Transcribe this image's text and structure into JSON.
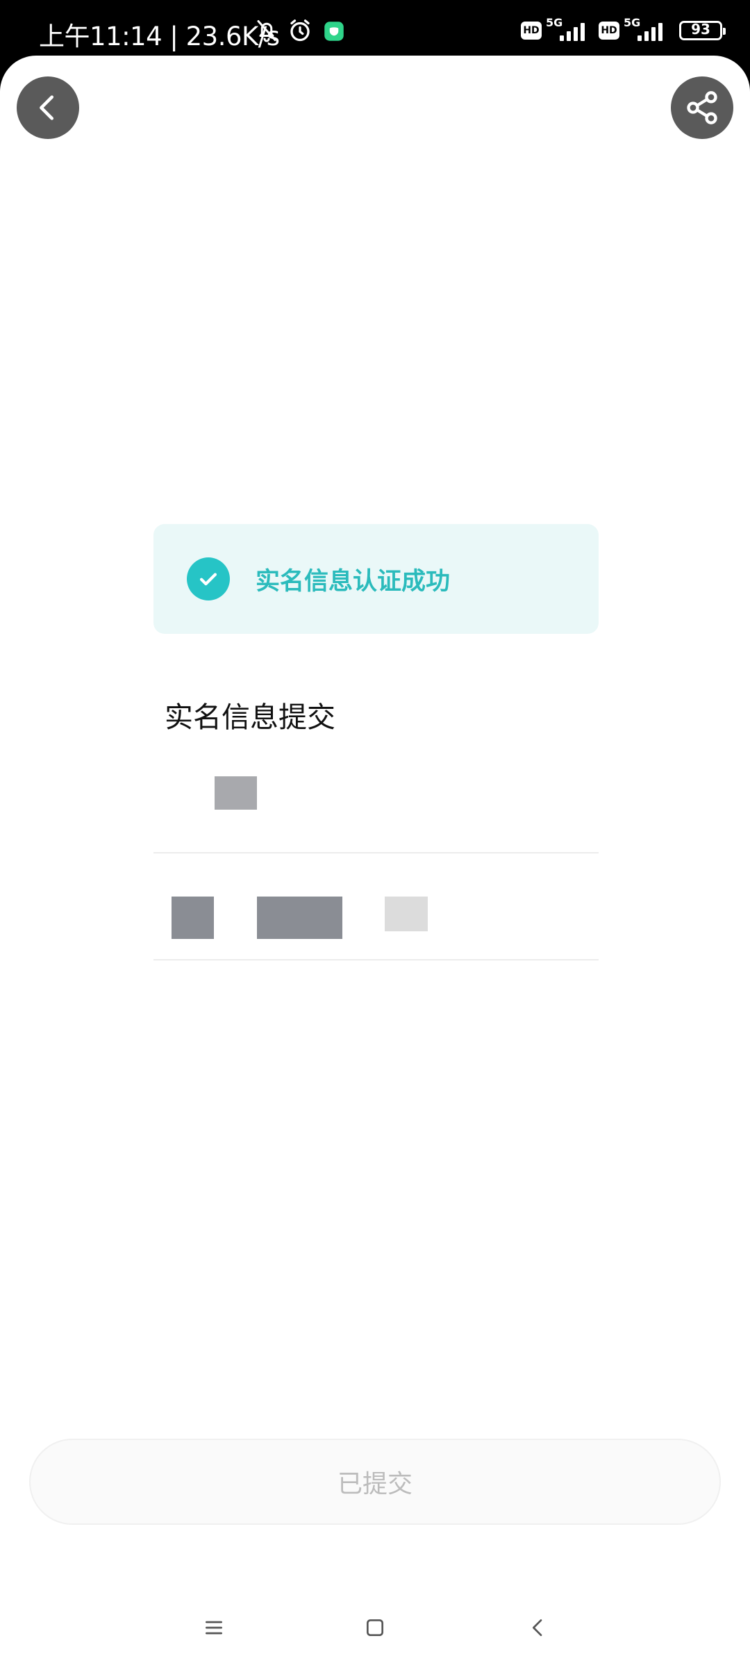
{
  "status_bar": {
    "time_network": "上午11:14 | 23.6K/s",
    "hd_label": "HD",
    "network_label": "5G",
    "battery_level": "93",
    "icons": [
      "bell-off-icon",
      "alarm-icon",
      "app-notification-icon",
      "hd-icon",
      "signal-icon",
      "battery-icon"
    ]
  },
  "header": {
    "back_icon": "chevron-left-icon",
    "share_icon": "share-icon"
  },
  "success_banner": {
    "icon": "check-circle-icon",
    "text": "实名信息认证成功",
    "accent_color": "#26c4c6",
    "background_color": "#eaf8f8"
  },
  "section": {
    "title": "实名信息提交"
  },
  "footer": {
    "submit_label": "已提交"
  },
  "nav_bar": {
    "icons": [
      "menu-icon",
      "home-icon",
      "back-icon"
    ]
  }
}
